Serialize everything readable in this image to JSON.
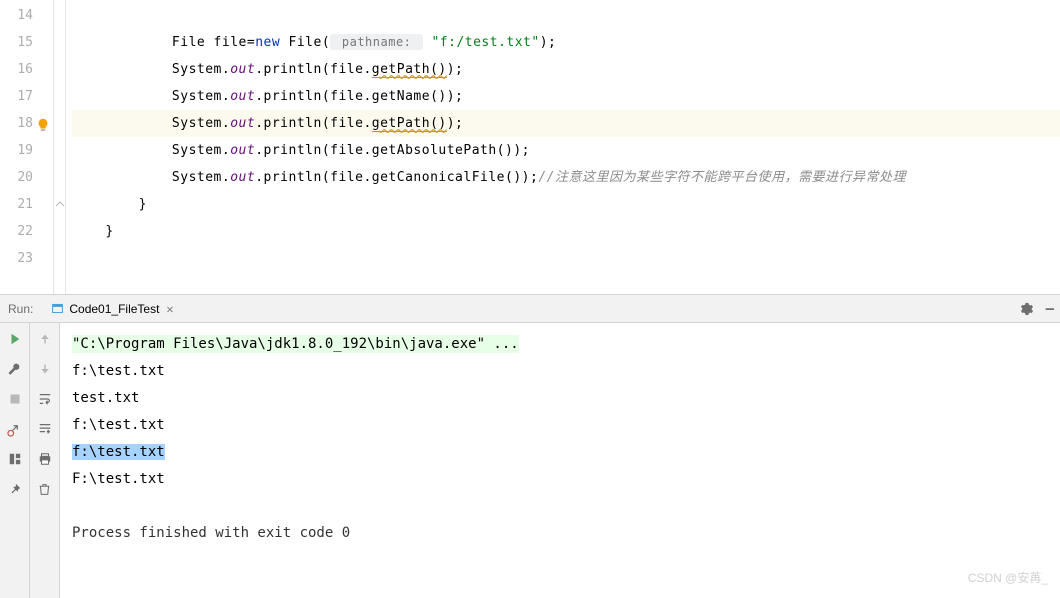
{
  "editor": {
    "lines": [
      {
        "num": "14",
        "indent": "        ",
        "tokens": []
      },
      {
        "num": "15",
        "indent": "            ",
        "tokens": [
          {
            "t": "File file=",
            "c": ""
          },
          {
            "t": "new",
            "c": "kw"
          },
          {
            "t": " File(",
            "c": ""
          },
          {
            "t": " pathname: ",
            "c": "hint"
          },
          {
            "t": " ",
            "c": ""
          },
          {
            "t": "\"f:/test.txt\"",
            "c": "st"
          },
          {
            "t": ");",
            "c": ""
          }
        ]
      },
      {
        "num": "16",
        "indent": "            ",
        "tokens": [
          {
            "t": "System.",
            "c": ""
          },
          {
            "t": "out",
            "c": "it"
          },
          {
            "t": ".println(file.",
            "c": ""
          },
          {
            "t": "getPath()",
            "c": "wn"
          },
          {
            "t": ");",
            "c": ""
          }
        ]
      },
      {
        "num": "17",
        "indent": "            ",
        "tokens": [
          {
            "t": "System.",
            "c": ""
          },
          {
            "t": "out",
            "c": "it"
          },
          {
            "t": ".println(file.getName());",
            "c": ""
          }
        ]
      },
      {
        "num": "18",
        "indent": "            ",
        "highlighted": true,
        "bulb": true,
        "tokens": [
          {
            "t": "System.",
            "c": ""
          },
          {
            "t": "out",
            "c": "it"
          },
          {
            "t": ".println(file.",
            "c": ""
          },
          {
            "t": "getPath()",
            "c": "wn"
          },
          {
            "t": ");",
            "c": ""
          }
        ]
      },
      {
        "num": "19",
        "indent": "            ",
        "tokens": [
          {
            "t": "System.",
            "c": ""
          },
          {
            "t": "out",
            "c": "it"
          },
          {
            "t": ".println(file.getAbsolutePath());",
            "c": ""
          }
        ]
      },
      {
        "num": "20",
        "indent": "            ",
        "tokens": [
          {
            "t": "System.",
            "c": ""
          },
          {
            "t": "out",
            "c": "it"
          },
          {
            "t": ".println(file.getCanonicalFile());",
            "c": ""
          },
          {
            "t": "//注意这里因为某些字符不能跨平台使用，需要进行异常处理",
            "c": "cm"
          }
        ]
      },
      {
        "num": "21",
        "indent": "        ",
        "fold": true,
        "tokens": [
          {
            "t": "}",
            "c": ""
          }
        ]
      },
      {
        "num": "22",
        "indent": "    ",
        "tokens": [
          {
            "t": "}",
            "c": ""
          }
        ]
      },
      {
        "num": "23",
        "indent": "",
        "tokens": []
      }
    ]
  },
  "run": {
    "label": "Run:",
    "tab_name": "Code01_FileTest",
    "console": [
      {
        "text": "\"C:\\Program Files\\Java\\jdk1.8.0_192\\bin\\java.exe\" ...",
        "style": "cmd"
      },
      {
        "text": "f:\\test.txt"
      },
      {
        "text": "test.txt"
      },
      {
        "text": "f:\\test.txt"
      },
      {
        "text": "f:\\test.txt",
        "style": "selected"
      },
      {
        "text": "F:\\test.txt"
      },
      {
        "text": ""
      },
      {
        "text": "Process finished with exit code 0",
        "style": "exit"
      }
    ]
  },
  "watermark": "CSDN @安苒_"
}
